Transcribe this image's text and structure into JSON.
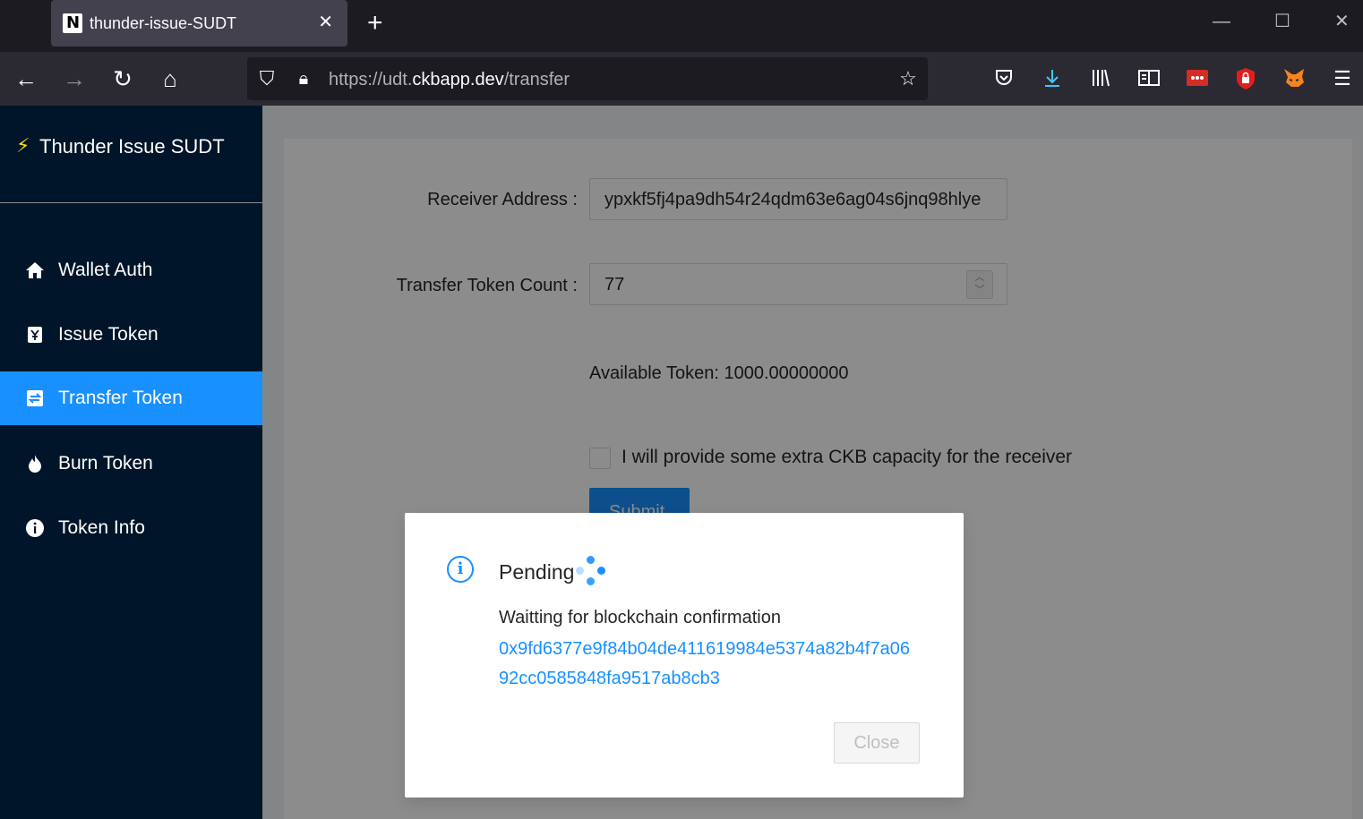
{
  "browser": {
    "tab_title": "thunder-issue-SUDT",
    "tab_favicon_letter": "N",
    "url": {
      "prefix": "https://udt.",
      "domain": "ckbapp.dev",
      "path": "/transfer"
    },
    "nav_icons": [
      "back-arrow-icon",
      "forward-arrow-icon",
      "reload-icon",
      "home-icon"
    ],
    "toolbar_icons": [
      "pocket-icon",
      "download-icon",
      "library-icon",
      "reader-view-icon",
      "lastpass-icon",
      "ublock-icon",
      "metamask-icon",
      "menu-icon"
    ]
  },
  "sidebar": {
    "app_title": "Thunder Issue SUDT",
    "items": [
      {
        "label": "Wallet Auth",
        "icon": "home-icon"
      },
      {
        "label": "Issue Token",
        "icon": "token-icon"
      },
      {
        "label": "Transfer Token",
        "icon": "transfer-icon"
      },
      {
        "label": "Burn Token",
        "icon": "fire-icon"
      },
      {
        "label": "Token Info",
        "icon": "info-icon"
      }
    ],
    "active_index": 2
  },
  "form": {
    "receiver_label": "Receiver Address",
    "receiver_value": "ypxkf5fj4pa9dh54r24qdm63e6ag04s6jnq98hlye",
    "count_label": "Transfer Token Count",
    "count_value": "77",
    "available": "Available Token: 1000.00000000",
    "checkbox_label": "I will provide some extra CKB capacity for the receiver",
    "submit_label": "Submit"
  },
  "modal": {
    "title": "Pending",
    "body": "Waitting for blockchain confirmation",
    "tx_hash": "0x9fd6377e9f84b04de411619984e5374a82b4f7a0692cc0585848fa9517ab8cb3",
    "close_label": "Close"
  },
  "colors": {
    "primary": "#1890ff",
    "sider_bg": "#001529",
    "tab_bg": "#1c1b22",
    "navbar_bg": "#2b2a33"
  }
}
